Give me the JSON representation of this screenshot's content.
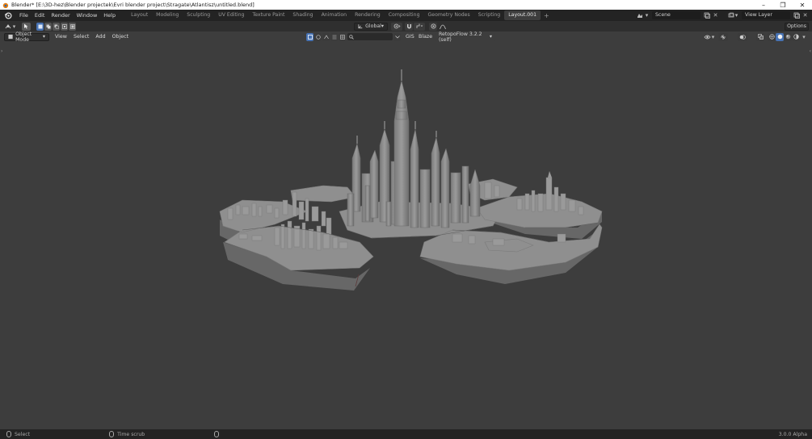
{
  "window": {
    "title": "Blender* [E:\\3D-hez\\Blender projectek\\Evri blender project\\Stragate\\Atlantisz\\untitled.blend]",
    "controls": [
      "–",
      "❐",
      "✕"
    ]
  },
  "menu": {
    "items": [
      "File",
      "Edit",
      "Render",
      "Window",
      "Help"
    ]
  },
  "workspaces": {
    "tabs": [
      "Layout",
      "Modeling",
      "Sculpting",
      "UV Editing",
      "Texture Paint",
      "Shading",
      "Animation",
      "Rendering",
      "Compositing",
      "Geometry Nodes",
      "Scripting",
      "Layout.001"
    ],
    "active": "Layout.001",
    "add_label": "+"
  },
  "scene": {
    "scene_name": "Scene",
    "view_layer": "View Layer"
  },
  "tool_header": {
    "transform_orientation": "Global",
    "options_label": "Options"
  },
  "viewport_header": {
    "mode": "Object Mode",
    "menus": [
      "View",
      "Select",
      "Add",
      "Object"
    ],
    "addons": [
      "GIS",
      "Blaze"
    ],
    "retopoflow": "RetopoFlow 3.2.2 (self)"
  },
  "status": {
    "select": "Select",
    "time_scrub": "Time scrub",
    "version": "3.0.0 Alpha"
  },
  "colors": {
    "accent": "#4772b3",
    "header": "#232323",
    "viewport_bg": "#3d3d3d",
    "model": "#8a8a8a"
  }
}
